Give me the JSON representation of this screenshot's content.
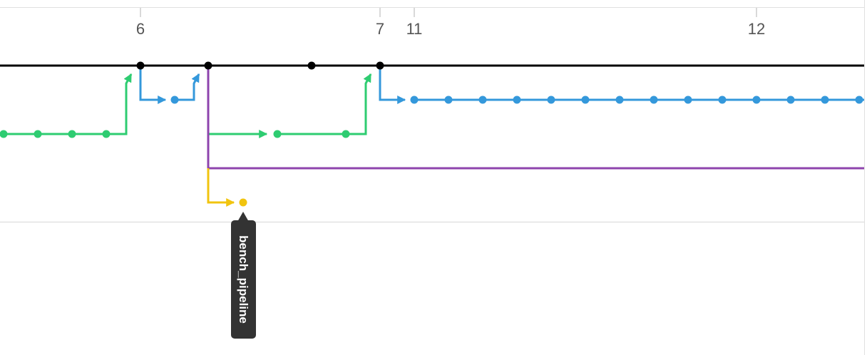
{
  "colors": {
    "master": "#000000",
    "blue_branch": "#3498db",
    "green_branch": "#2ecc71",
    "purple_branch": "#8e44ad",
    "yellow_branch": "#f1c40f",
    "label_bg": "#333333",
    "grid_line": "#d8d8d8",
    "tick_text": "#555555"
  },
  "timeline": {
    "ticks": [
      "6",
      "7",
      "11",
      "12"
    ]
  },
  "graph": {
    "branch_label": "bench_pipeline",
    "branch_label_icon": "tag-pointer-icon"
  }
}
